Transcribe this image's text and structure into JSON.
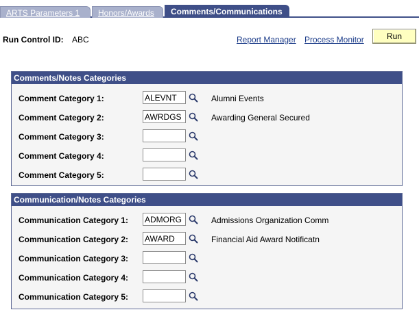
{
  "tabs": [
    {
      "label": "ARTS Parameters 1",
      "active": false
    },
    {
      "label": "Honors/Awards",
      "active": false
    },
    {
      "label": "Comments/Communications",
      "active": true
    }
  ],
  "run_control": {
    "label": "Run Control ID:",
    "value": "ABC",
    "report_manager": "Report Manager",
    "process_monitor": "Process Monitor",
    "run_button": "Run"
  },
  "comments": {
    "title": "Comments/Notes Categories",
    "rows": [
      {
        "label": "Comment Category 1:",
        "value": "ALEVNT",
        "desc": "Alumni Events"
      },
      {
        "label": "Comment Category 2:",
        "value": "AWRDGS",
        "desc": "Awarding General Secured"
      },
      {
        "label": "Comment Category 3:",
        "value": "",
        "desc": ""
      },
      {
        "label": "Comment Category 4:",
        "value": "",
        "desc": ""
      },
      {
        "label": "Comment Category 5:",
        "value": "",
        "desc": ""
      }
    ]
  },
  "communication": {
    "title": "Communication/Notes Categories",
    "rows": [
      {
        "label": "Communication Category 1:",
        "value": "ADMORG",
        "desc": "Admissions Organization Comm"
      },
      {
        "label": "Communication Category 2:",
        "value": "AWARD",
        "desc": "Financial Aid Award Notificatn"
      },
      {
        "label": "Communication Category 3:",
        "value": "",
        "desc": ""
      },
      {
        "label": "Communication Category 4:",
        "value": "",
        "desc": ""
      },
      {
        "label": "Communication Category 5:",
        "value": "",
        "desc": ""
      }
    ]
  },
  "colors": {
    "header_bg": "#3f4f88",
    "run_button_bg": "#ffffc0",
    "link": "#1d3d8a"
  },
  "icons": {
    "lookup": "magnifier-lookup-icon"
  }
}
